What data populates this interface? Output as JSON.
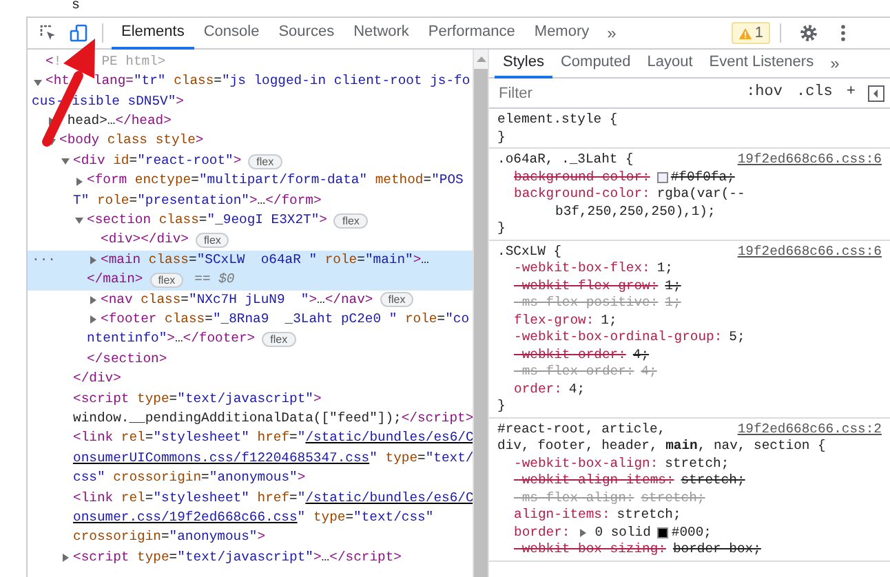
{
  "top_fragment": "s",
  "toolbar": {
    "tools": [
      {
        "kind": "inspect",
        "selected": false
      },
      {
        "kind": "device",
        "selected": true
      }
    ],
    "tabs": [
      {
        "label": "Elements",
        "selected": true
      },
      {
        "label": "Console",
        "selected": false
      },
      {
        "label": "Sources",
        "selected": false
      },
      {
        "label": "Network",
        "selected": false
      },
      {
        "label": "Performance",
        "selected": false
      },
      {
        "label": "Memory",
        "selected": false
      }
    ],
    "more": "»",
    "warning": {
      "count": "1"
    },
    "actions": [
      {
        "kind": "settings"
      },
      {
        "kind": "menu"
      }
    ]
  },
  "elements": {
    "nodes": [
      {
        "selected": false,
        "lines": [
          {
            "parts": [
              {
                "kind": "code",
                "text": "<!"
              },
              {
                "kind": "covered"
              },
              {
                "kind": "covered"
              },
              {
                "kind": "covered"
              },
              {
                "kind": "covered"
              },
              {
                "kind": "covered"
              },
              {
                "kind": "code",
                "text": "PE html>"
              }
            ]
          }
        ]
      },
      {
        "selected": false,
        "expanded": true,
        "lines": [
          {
            "parts": [
              {
                "kind": "code",
                "text": "<ht"
              },
              {
                "kind": "covered"
              },
              {
                "kind": "covered"
              },
              {
                "kind": "covered"
              },
              {
                "kind": "code",
                "text": "lang=\"tr\" class=\"js logged-in client-root js-fo"
              }
            ]
          },
          {
            "parts": [
              {
                "kind": "code",
                "text": "cus-"
              },
              {
                "kind": "covered"
              },
              {
                "kind": "code",
                "text": "isible sDN5V\">"
              }
            ]
          }
        ],
        "children": [
          {
            "selected": false,
            "expanded": false,
            "lines": [
              {
                "parts": [
                  {
                    "kind": "covered"
                  },
                  {
                    "kind": "code",
                    "text": "head>…</head>"
                  }
                ]
              }
            ]
          },
          {
            "selected": false,
            "expanded": true,
            "lines": [
              "<body class style>"
            ],
            "children": [
              {
                "selected": false,
                "expanded": true,
                "badge": "flex",
                "lines": [
                  "<div id=\"react-root\">"
                ],
                "close": "</div>",
                "children": [
                  {
                    "selected": false,
                    "expanded": false,
                    "lines": [
                      "<form enctype=\"multipart/form-data\" method=\"POS",
                      "T\" role=\"presentation\">…</form>"
                    ]
                  },
                  {
                    "selected": false,
                    "expanded": true,
                    "badge": "flex",
                    "lines": [
                      "<section class=\"_9eogI E3X2T\">"
                    ],
                    "close": "</section>",
                    "children": [
                      {
                        "selected": false,
                        "badge": "flex",
                        "lines": [
                          "<div></div>"
                        ]
                      },
                      {
                        "selected": true,
                        "expanded": false,
                        "row_menu": "···",
                        "badge": "flex",
                        "marker": "== $0",
                        "lines": [
                          "<main class=\"SCxLW  o64aR \" role=\"main\">…",
                          "</main>"
                        ]
                      },
                      {
                        "selected": false,
                        "expanded": false,
                        "badge": "flex",
                        "lines": [
                          "<nav class=\"NXc7H jLuN9  \">…</nav>"
                        ]
                      },
                      {
                        "selected": false,
                        "expanded": false,
                        "badge": "flex",
                        "lines": [
                          "<footer class=\"_8Rna9  _3Laht pC2e0 \" role=\"co",
                          "ntentinfo\">…</footer>"
                        ]
                      }
                    ]
                  }
                ]
              },
              {
                "selected": false,
                "lines": [
                  "<script type=\"text/javascript\">",
                  "window.__pendingAdditionalData([\"feed\"]);</script>"
                ]
              },
              {
                "selected": false,
                "lines": [
                  {
                    "parts": [
                      {
                        "kind": "code",
                        "text": "<link rel=\"stylesheet\" href=\""
                      },
                      {
                        "kind": "link",
                        "text": "/static/bundles/es6/C"
                      }
                    ]
                  },
                  {
                    "parts": [
                      {
                        "kind": "link",
                        "text": "onsumerUICommons.css/f12204685347.css"
                      },
                      {
                        "kind": "code",
                        "text": "\" type=\"text/"
                      }
                    ]
                  },
                  "css\" crossorigin=\"anonymous\">"
                ]
              },
              {
                "selected": false,
                "lines": [
                  {
                    "parts": [
                      {
                        "kind": "code",
                        "text": "<link rel=\"stylesheet\" href=\""
                      },
                      {
                        "kind": "link",
                        "text": "/static/bundles/es6/C"
                      }
                    ]
                  },
                  {
                    "parts": [
                      {
                        "kind": "link",
                        "text": "onsumer.css/19f2ed668c66.css"
                      },
                      {
                        "kind": "code",
                        "text": "\" type=\"text/css\""
                      }
                    ]
                  },
                  "crossorigin=\"anonymous\">"
                ]
              },
              {
                "selected": false,
                "expanded": false,
                "lines": [
                  "<script type=\"text/javascript\">…</script>"
                ]
              }
            ]
          }
        ]
      }
    ]
  },
  "styles": {
    "tabs": [
      {
        "label": "Styles",
        "selected": true
      },
      {
        "label": "Computed",
        "selected": false
      },
      {
        "label": "Layout",
        "selected": false
      },
      {
        "label": "Event Listeners",
        "selected": false
      }
    ],
    "more": "»",
    "filter": {
      "placeholder": "Filter"
    },
    "buttons": [
      ":hov",
      ".cls",
      "+"
    ],
    "rules": [
      {
        "selector_lines": [
          "element.style {"
        ],
        "closing": "}"
      },
      {
        "selector_lines": [
          ".o64aR, ._3Laht {"
        ],
        "source": "19f2ed668c66.css:6",
        "closing": "}",
        "props": [
          {
            "name": "background-color:",
            "color": "#f0f0fa",
            "value": "#f0f0fa;",
            "struck": true,
            "faded": false
          },
          {
            "name": "background-color:",
            "value": "rgba(var(--",
            "wrap": "b3f,250,250,250),1);",
            "struck": false,
            "faded": false
          }
        ]
      },
      {
        "selector_lines": [
          ".SCxLW {"
        ],
        "source": "19f2ed668c66.css:6",
        "closing": "}",
        "props": [
          {
            "name": "-webkit-box-flex:",
            "value": "1;",
            "struck": false,
            "faded": false
          },
          {
            "name": "-webkit-flex-grow:",
            "value": "1;",
            "struck": true,
            "faded": false
          },
          {
            "name": "-ms-flex-positive:",
            "value": "1;",
            "struck": true,
            "faded": true
          },
          {
            "name": "flex-grow:",
            "value": "1;",
            "struck": false,
            "faded": false
          },
          {
            "name": "-webkit-box-ordinal-group:",
            "value": "5;",
            "struck": false,
            "faded": false
          },
          {
            "name": "-webkit-order:",
            "value": "4;",
            "struck": true,
            "faded": false
          },
          {
            "name": "-ms-flex-order:",
            "value": "4;",
            "struck": true,
            "faded": true
          },
          {
            "name": "order:",
            "value": "4;",
            "struck": false,
            "faded": false
          }
        ]
      },
      {
        "selector_lines": [
          "#react-root, article,",
          "div, footer, header, **main**, nav, section {"
        ],
        "source": "19f2ed668c66.css:2",
        "props": [
          {
            "name": "-webkit-box-align:",
            "value": "stretch;",
            "struck": false,
            "faded": false
          },
          {
            "name": "-webkit-align-items:",
            "value": "stretch;",
            "struck": true,
            "faded": false
          },
          {
            "name": "-ms-flex-align:",
            "value": "stretch;",
            "struck": true,
            "faded": true
          },
          {
            "name": "align-items:",
            "value": "stretch;",
            "struck": false,
            "faded": false
          },
          {
            "name": "border:",
            "expandable": true,
            "prefix": "0 solid",
            "color": "#000000",
            "value": "#000;",
            "struck": false,
            "faded": false
          },
          {
            "name": "-webkit-box-sizing:",
            "value": "border-box;",
            "struck": true,
            "faded": false
          }
        ]
      }
    ]
  },
  "annotation": {
    "kind": "arrow"
  }
}
